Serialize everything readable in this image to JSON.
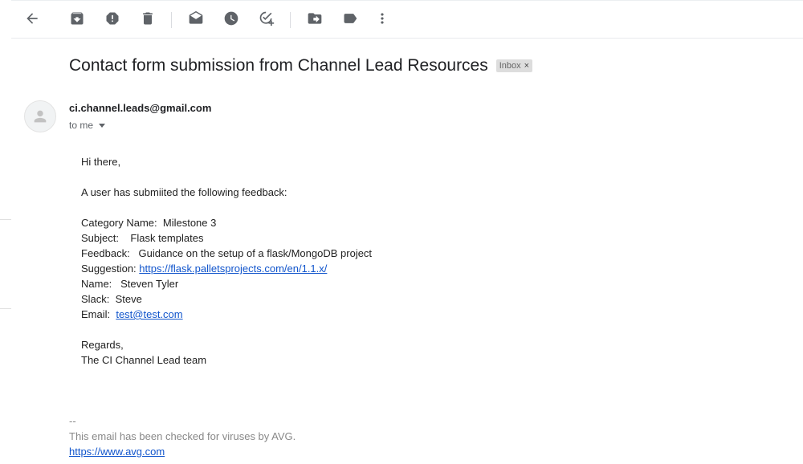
{
  "toolbar": {
    "buttons": [
      {
        "icon": "back-arrow-icon",
        "label": "Back"
      },
      {
        "icon": "archive-icon",
        "label": "Archive"
      },
      {
        "icon": "report-spam-icon",
        "label": "Report spam"
      },
      {
        "icon": "delete-icon",
        "label": "Delete"
      },
      {
        "icon": "mark-unread-icon",
        "label": "Mark as unread"
      },
      {
        "icon": "snooze-icon",
        "label": "Snooze"
      },
      {
        "icon": "add-task-icon",
        "label": "Add to Tasks"
      },
      {
        "icon": "move-to-icon",
        "label": "Move to"
      },
      {
        "icon": "labels-icon",
        "label": "Labels"
      },
      {
        "icon": "more-icon",
        "label": "More"
      }
    ]
  },
  "email": {
    "subject": "Contact form submission from Channel Lead Resources",
    "label": "Inbox",
    "label_close": "×",
    "sender": "ci.channel.leads@gmail.com",
    "recipient": "to me",
    "greeting": "Hi there,",
    "intro": "A user has submiited the following feedback:",
    "fields": {
      "category": "Category Name:  Milestone 3",
      "subject": "Subject:    Flask templates",
      "feedback": "Feedback:   Guidance on the setup of a flask/MongoDB project",
      "suggestion_label": "Suggestion: ",
      "suggestion_link": "https://flask.palletsprojects.com/en/1.1.x/",
      "name": "Name:   Steven Tyler",
      "slack": "Slack:  Steve",
      "email_label": "Email:  ",
      "email_link": "test@test.com"
    },
    "regards": "Regards,",
    "team": "The CI Channel Lead team",
    "signature": {
      "dashes": "--",
      "text": "This email has been checked for viruses by AVG.",
      "link": "https://www.avg.com"
    }
  }
}
